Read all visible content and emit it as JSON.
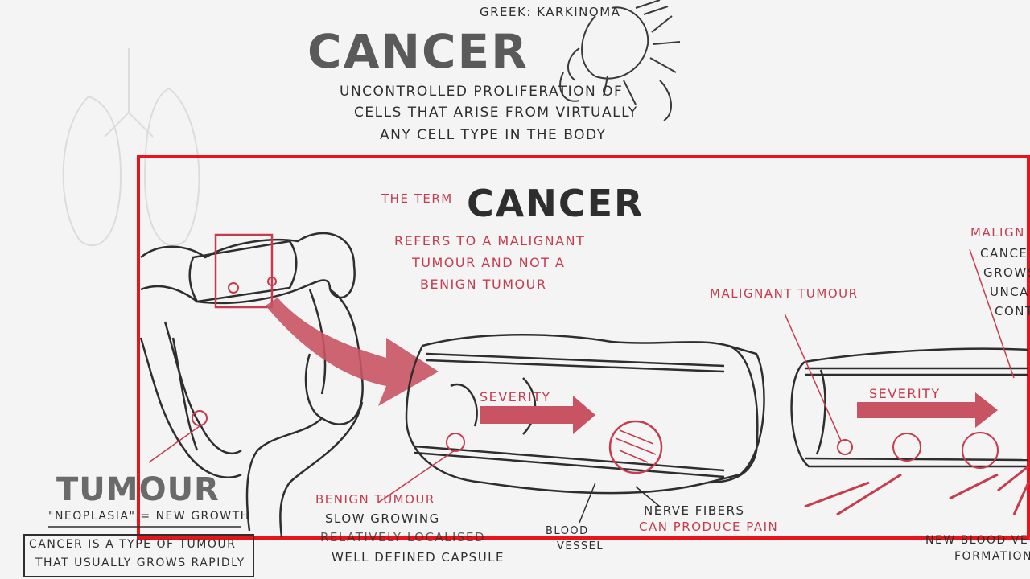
{
  "colors": {
    "ink": "#2e2e2e",
    "accent_red": "#c63b4e",
    "highlight_box": "#e8141c",
    "background": "#f4f4f4",
    "arrow_fill": "#c85463"
  },
  "header": {
    "greek": "GREEK: KARKINOMA",
    "title": "CANCER",
    "definition": [
      "UNCONTROLLED PROLIFERATION OF",
      "CELLS THAT ARISE FROM VIRTUALLY",
      "ANY CELL TYPE IN THE BODY"
    ]
  },
  "highlight": {
    "the_term": "THE TERM",
    "cancer_word": "CANCER",
    "refers": [
      "REFERS TO A MALIGNANT",
      "TUMOUR AND NOT A",
      "BENIGN TUMOUR"
    ]
  },
  "colon_diagram": {
    "severity_1": "SEVERITY",
    "severity_2": "SEVERITY",
    "malignant_tumour": "MALIGNANT TUMOUR",
    "malig_partial": "MALIGN",
    "malig_side": [
      "CANCE",
      "GROWS",
      "UNCAP",
      "CONT"
    ],
    "benign_tumour": "BENIGN TUMOUR",
    "benign_desc": [
      "SLOW GROWING",
      "RELATIVELY LOCALISED",
      "WELL DEFINED CAPSULE"
    ],
    "blood_vessel": [
      "BLOOD",
      "VESSEL"
    ],
    "nerve_fibers": [
      "NERVE FIBERS",
      "CAN PRODUCE PAIN"
    ],
    "new_blood": [
      "NEW BLOOD VE",
      "FORMATION"
    ]
  },
  "tumour_panel": {
    "title": "TUMOUR",
    "neoplasia": "\"NEOPLASIA\" = NEW GROWTH",
    "note": [
      "CANCER IS A TYPE OF TUMOUR",
      "THAT USUALLY GROWS RAPIDLY"
    ]
  }
}
